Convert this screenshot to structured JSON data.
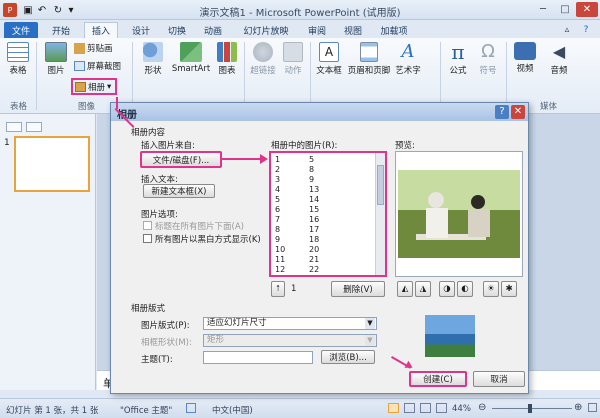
{
  "window": {
    "title": "演示文稿1 - Microsoft PowerPoint (试用版)"
  },
  "tabs": [
    "文件",
    "开始",
    "插入",
    "设计",
    "切换",
    "动画",
    "幻灯片放映",
    "审阅",
    "视图",
    "加载项"
  ],
  "ribbon": {
    "table": "表格",
    "picture": "图片",
    "clipart": "剪贴画",
    "screenshot": "屏幕截图",
    "album": "相册",
    "shapes": "形状",
    "smartart": "SmartArt",
    "chart": "图表",
    "hyperlink": "超链接",
    "action": "动作",
    "textbox": "文本框",
    "headerfooter": "页眉和页脚",
    "wordart": "艺术字",
    "equation": "公式",
    "symbol": "符号",
    "video": "视频",
    "audio": "音频",
    "groups": {
      "table": "表格",
      "images": "图像",
      "media": "媒体"
    }
  },
  "slides": {
    "number": "1"
  },
  "notes": {
    "placeholder": "单击"
  },
  "dialog": {
    "title": "相册",
    "content_label": "相册内容",
    "insert_from": "插入图片来自:",
    "file_disk_button": "文件/磁盘(F)...",
    "insert_text": "插入文本:",
    "new_textbox_button": "新建文本框(X)",
    "picture_options": "图片选项:",
    "caption_below": "标题在所有图片下面(A)",
    "all_bw": "所有图片以黑白方式显示(K)",
    "pictures_in_album": "相册中的图片(R):",
    "preview": "预览:",
    "list_left": [
      "1",
      "2",
      "3",
      "4",
      "5",
      "6",
      "7",
      "8",
      "9",
      "10",
      "11",
      "12"
    ],
    "list_right": [
      "5",
      "8",
      "9",
      "13",
      "14",
      "15",
      "16",
      "17",
      "18",
      "20",
      "21",
      "22"
    ],
    "delete_button": "删除(V)",
    "order_value": "1",
    "layout_label": "相册版式",
    "picture_layout": "图片版式(P):",
    "picture_layout_value": "适应幻灯片尺寸",
    "frame_shape": "相框形状(M):",
    "frame_shape_value": "矩形",
    "theme": "主题(T):",
    "browse_button": "浏览(B)...",
    "create_button": "创建(C)",
    "cancel_button": "取消"
  },
  "status": {
    "slide_info": "幻灯片 第 1 张，共 1 张",
    "theme": "\"Office 主题\"",
    "language": "中文(中国)",
    "zoom": "44%"
  },
  "colors": {
    "highlight": "#e0338a",
    "file_tab": "#2a6fc6"
  }
}
